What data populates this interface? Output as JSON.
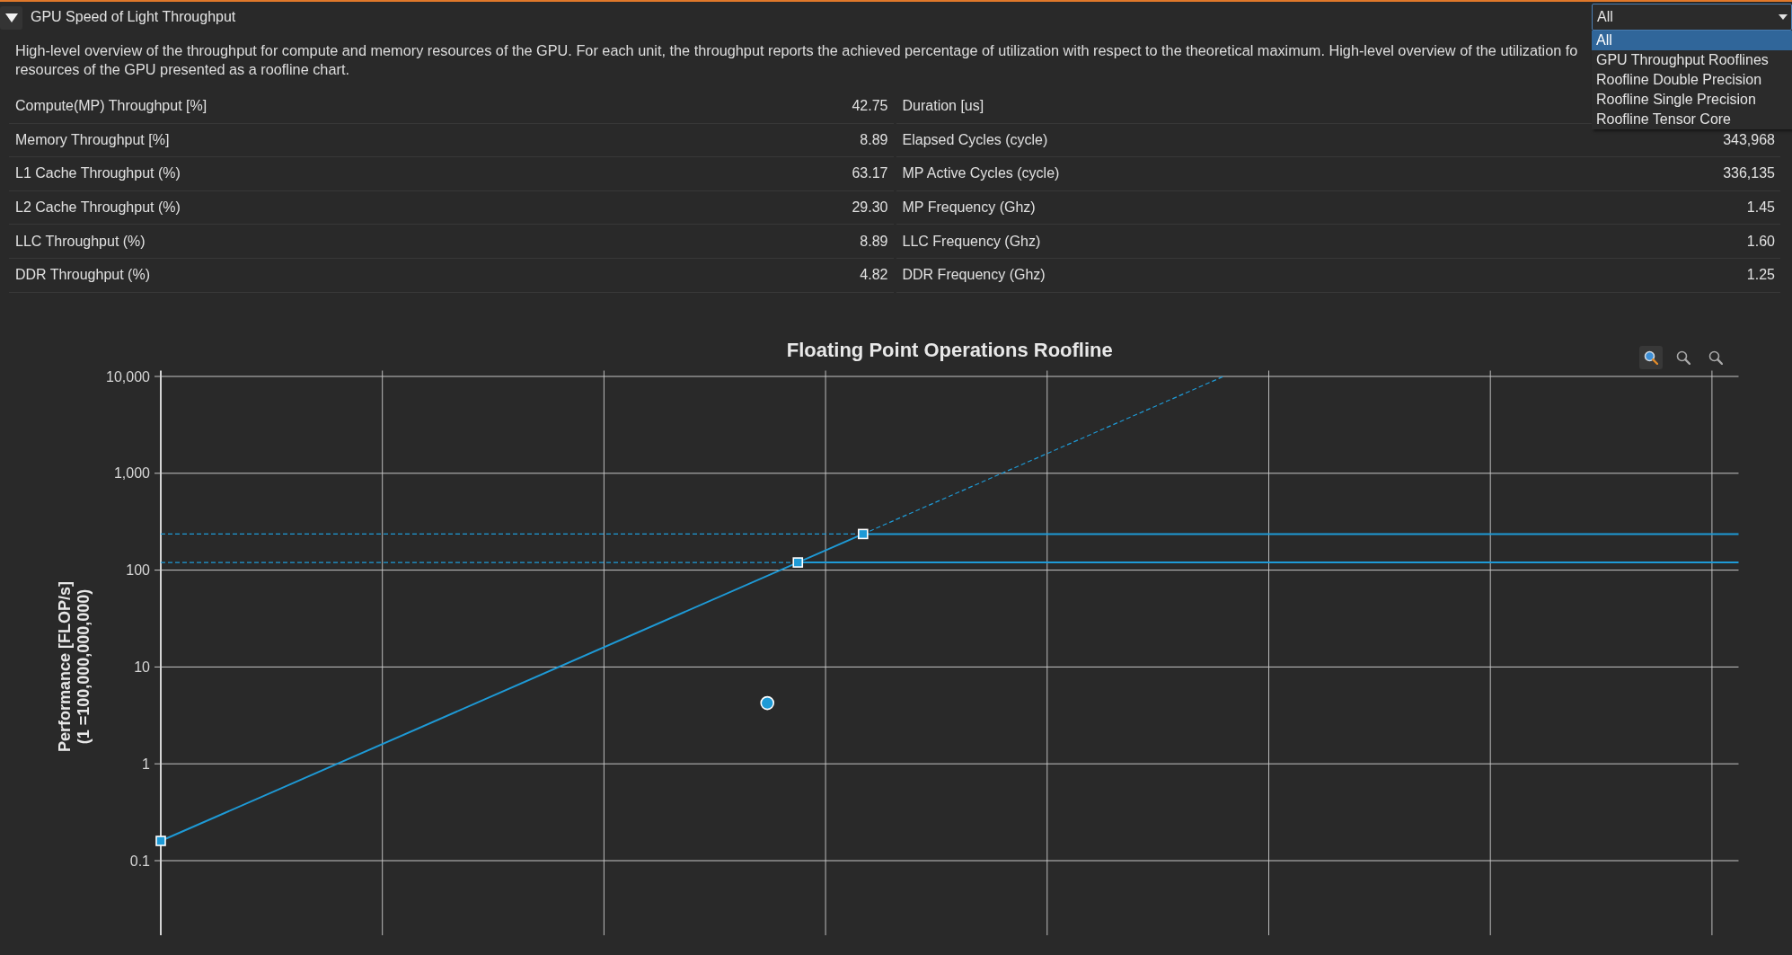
{
  "section": {
    "title": "GPU Speed of Light Throughput",
    "expanded": true,
    "description_lines": [
      "High-level overview of the throughput for compute and memory resources of the GPU. For each unit, the throughput reports the achieved percentage of utilization with respect to the theoretical maximum. High-level overview of the utilization fo",
      "resources of the GPU presented as a roofline chart."
    ]
  },
  "view_select": {
    "value": "All",
    "expanded": true,
    "options": [
      {
        "label": "All",
        "selected": true
      },
      {
        "label": "GPU Throughput Rooflines",
        "selected": false
      },
      {
        "label": "Roofline Double Precision",
        "selected": false
      },
      {
        "label": "Roofline Single Precision",
        "selected": false
      },
      {
        "label": "Roofline Tensor Core",
        "selected": false
      }
    ]
  },
  "metrics": {
    "left": [
      {
        "label": "Compute(MP) Throughput [%]",
        "value": "42.75"
      },
      {
        "label": "Memory Throughput [%]",
        "value": "8.89"
      },
      {
        "label": "L1 Cache Throughput (%)",
        "value": "63.17"
      },
      {
        "label": "L2 Cache Throughput (%)",
        "value": "29.30"
      },
      {
        "label": "LLC Throughput (%)",
        "value": "8.89"
      },
      {
        "label": "DDR Throughput (%)",
        "value": "4.82"
      }
    ],
    "right": [
      {
        "label": "Duration [us]"
      },
      {
        "label": "Elapsed Cycles (cycle)",
        "value": "343,968"
      },
      {
        "label": "MP Active Cycles (cycle)",
        "value": "336,135"
      },
      {
        "label": "MP Frequency (Ghz)",
        "value": "1.45"
      },
      {
        "label": "LLC Frequency (Ghz)",
        "value": "1.60"
      },
      {
        "label": "DDR Frequency (Ghz)",
        "value": "1.25"
      }
    ]
  },
  "chart": {
    "title": "Floating Point Operations Roofline",
    "tools": [
      {
        "selected": true
      },
      {
        "selected": false
      },
      {
        "selected": false
      }
    ],
    "axis_title_lines": [
      "Performance [FLOP/s]",
      "(1 =100,000,000,000)"
    ],
    "tick_labels": [
      "10,000",
      "1,000",
      "100",
      "10",
      "1",
      "0.1"
    ]
  }
}
